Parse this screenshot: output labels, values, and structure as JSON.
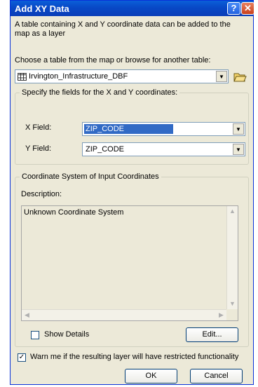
{
  "window": {
    "title": "Add XY Data",
    "help_glyph": "?",
    "close_glyph": "✕"
  },
  "intro_text": "A table containing X and Y coordinate data can be added to the map as a layer",
  "table_select": {
    "label": "Choose a table from the map or browse for another table:",
    "value": "Irvington_Infrastructure_DBF"
  },
  "xy_fields": {
    "legend": "Specify the fields for the X and Y coordinates:",
    "x_label": "X Field:",
    "x_value": "ZIP_CODE",
    "y_label": "Y Field:",
    "y_value": "ZIP_CODE"
  },
  "coord_system": {
    "legend": "Coordinate System of Input Coordinates",
    "description_label": "Description:",
    "description_text": "Unknown Coordinate System",
    "show_details_label": "Show Details",
    "show_details_checked": false,
    "edit_label": "Edit..."
  },
  "warn": {
    "label": "Warn me if the resulting layer will have restricted functionality",
    "checked": true
  },
  "buttons": {
    "ok": "OK",
    "cancel": "Cancel"
  },
  "icons": {
    "table": "table-icon",
    "browse": "open-folder-icon",
    "dropdown": "chevron-down-icon"
  }
}
